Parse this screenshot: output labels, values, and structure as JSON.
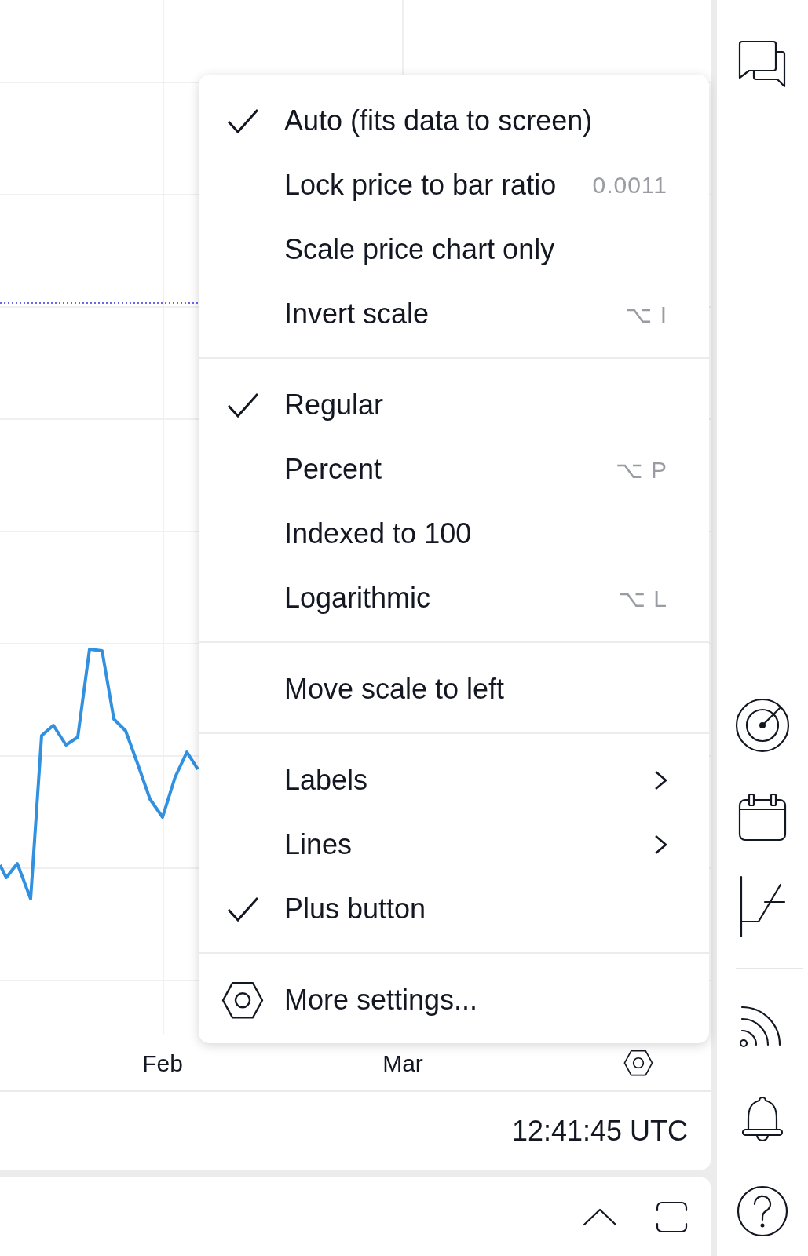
{
  "chart": {
    "x_labels": [
      {
        "label": "Feb"
      },
      {
        "label": "Mar"
      }
    ]
  },
  "scale_menu": {
    "sections": [
      {
        "items": [
          {
            "kind": "option",
            "label": "Auto (fits data to screen)",
            "checked": true
          },
          {
            "kind": "option",
            "label": "Lock price to bar ratio",
            "checked": false,
            "value": "0.0011"
          },
          {
            "kind": "option",
            "label": "Scale price chart only",
            "checked": false
          },
          {
            "kind": "option",
            "label": "Invert scale",
            "checked": false,
            "shortcut": "⌥ I"
          }
        ]
      },
      {
        "items": [
          {
            "kind": "option",
            "label": "Regular",
            "checked": true
          },
          {
            "kind": "option",
            "label": "Percent",
            "checked": false,
            "shortcut": "⌥ P"
          },
          {
            "kind": "option",
            "label": "Indexed to 100",
            "checked": false
          },
          {
            "kind": "option",
            "label": "Logarithmic",
            "checked": false,
            "shortcut": "⌥ L"
          }
        ]
      },
      {
        "items": [
          {
            "kind": "option",
            "label": "Move scale to left",
            "checked": false
          }
        ]
      },
      {
        "items": [
          {
            "kind": "submenu",
            "label": "Labels",
            "checked": false
          },
          {
            "kind": "submenu",
            "label": "Lines",
            "checked": false
          },
          {
            "kind": "option",
            "label": "Plus button",
            "checked": true
          }
        ]
      },
      {
        "items": [
          {
            "kind": "settings",
            "label": "More settings...",
            "checked": false
          }
        ]
      }
    ]
  },
  "status_bar": {
    "clock": "12:41:45 UTC"
  }
}
